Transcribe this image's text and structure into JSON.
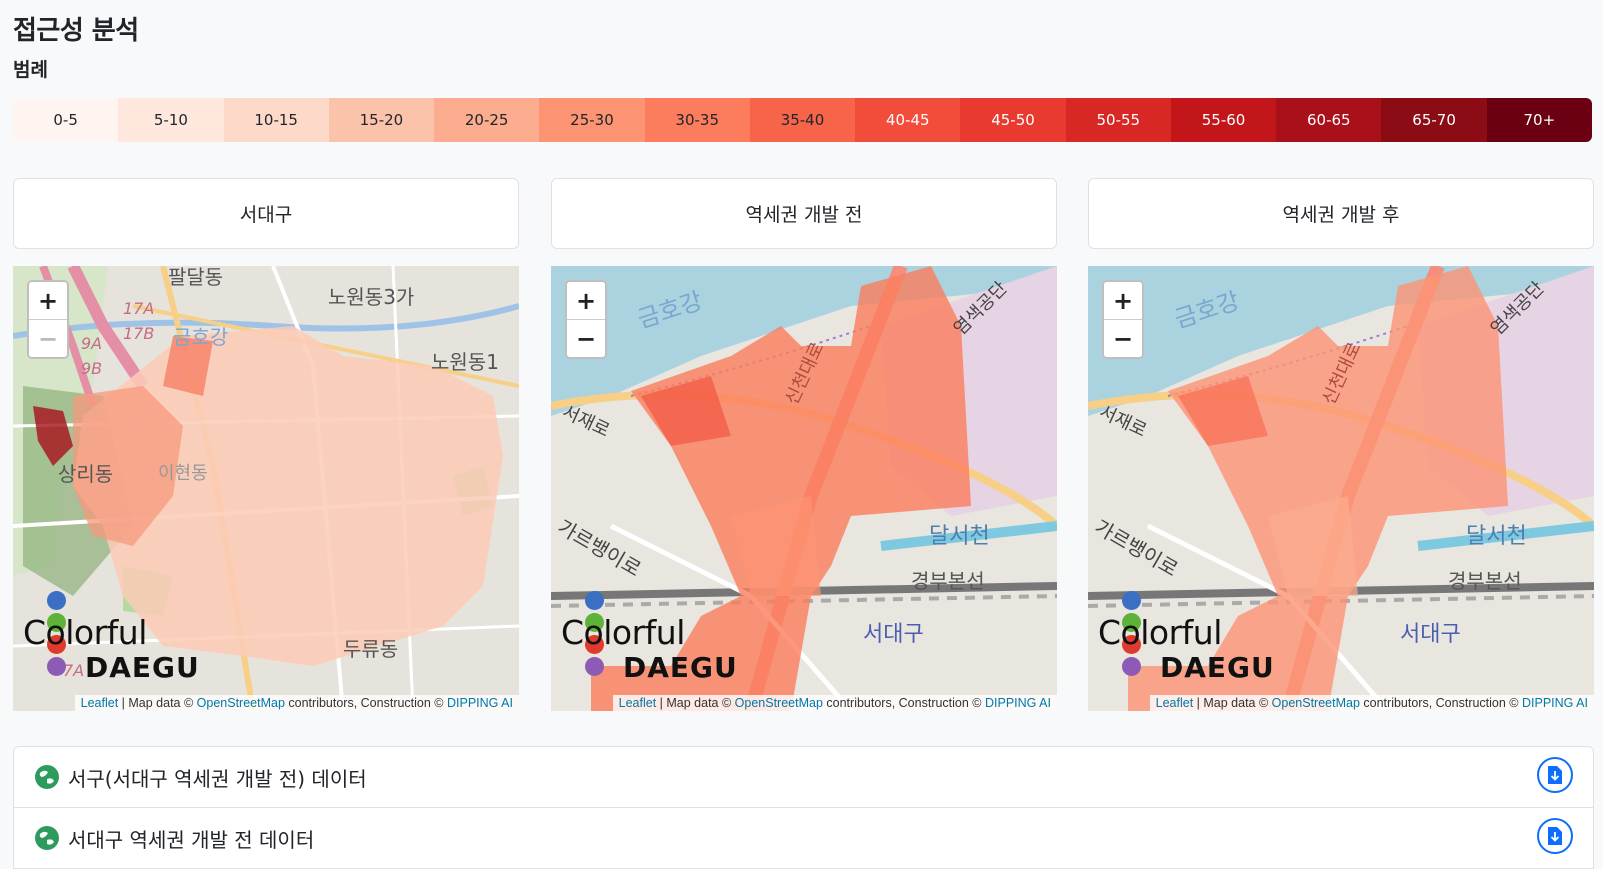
{
  "page": {
    "title": "접근성 분석",
    "legend_title": "범례"
  },
  "legend": [
    {
      "label": "0-5",
      "color": "#fff5f0",
      "text": "#212529"
    },
    {
      "label": "5-10",
      "color": "#fee8de",
      "text": "#212529"
    },
    {
      "label": "10-15",
      "color": "#fdd9c9",
      "text": "#212529"
    },
    {
      "label": "15-20",
      "color": "#fcc3ab",
      "text": "#212529"
    },
    {
      "label": "20-25",
      "color": "#fcac8f",
      "text": "#212529"
    },
    {
      "label": "25-30",
      "color": "#fc9474",
      "text": "#212529"
    },
    {
      "label": "30-35",
      "color": "#fb7d5d",
      "text": "#212529"
    },
    {
      "label": "35-40",
      "color": "#f6644a",
      "text": "#212529"
    },
    {
      "label": "40-45",
      "color": "#f14d3a",
      "text": "#ffffff"
    },
    {
      "label": "45-50",
      "color": "#e83a2f",
      "text": "#ffffff"
    },
    {
      "label": "50-55",
      "color": "#d72826",
      "text": "#ffffff"
    },
    {
      "label": "55-60",
      "color": "#c3161b",
      "text": "#ffffff"
    },
    {
      "label": "60-65",
      "color": "#a8101a",
      "text": "#ffffff"
    },
    {
      "label": "65-70",
      "color": "#8c0c16",
      "text": "#ffffff"
    },
    {
      "label": "70+",
      "color": "#6a0011",
      "text": "#ffffff"
    }
  ],
  "panels": [
    {
      "button_label": "서대구"
    },
    {
      "button_label": "역세권 개발 전"
    },
    {
      "button_label": "역세권 개발 후"
    }
  ],
  "map": {
    "zoom_in": "+",
    "zoom_out": "−",
    "logo_colorful": "Colorful",
    "logo_daegu": "DAEGU",
    "logo_dot_colors": [
      "#3a6fc4",
      "#5db33a",
      "#e03a2e",
      "#8d5bb5",
      "#f2b01e"
    ],
    "attr_leaflet": "Leaflet",
    "attr_mapdata": "| Map data ©",
    "attr_osm": "OpenStreetMap",
    "attr_contrib": "contributors, Construction ©",
    "attr_dipping": "DIPPING AI",
    "labels_seodaegu": {
      "palDal": "팔달동",
      "nowon3": "노원동3가",
      "nowon1": "노원동1",
      "sangri": "상리동",
      "ihyeon": "이현동",
      "duryu": "두류동",
      "geumho": "금호강",
      "r17a": "17A",
      "r17b": "17B",
      "r9a": "9A",
      "r9b": "9B",
      "r7a": "7A"
    },
    "labels_station": {
      "geumho": "금호강",
      "seojae": "서재로",
      "dalseo": "달서천",
      "gyeongbu": "경부본선",
      "seodaegu": "서대구",
      "gareu": "가르뱅이로",
      "yeomsaek": "염색공단",
      "sincheon": "신천대로"
    }
  },
  "datasets": [
    {
      "label": "서구(서대구 역세권 개발 전) 데이터"
    },
    {
      "label": "서대구 역세권 개발 전 데이터"
    }
  ]
}
